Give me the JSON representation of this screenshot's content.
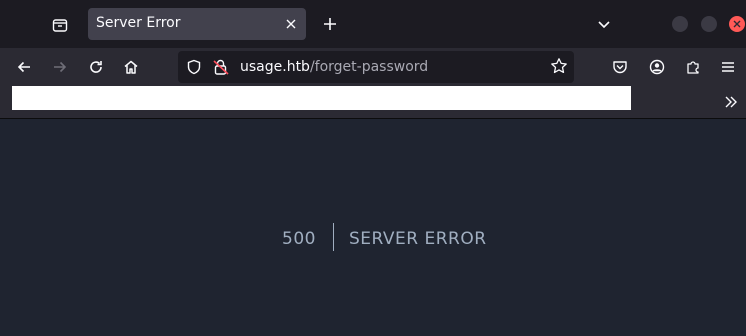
{
  "browser": {
    "tab": {
      "title": "Server Error"
    },
    "url": {
      "host": "usage.htb",
      "path": "/forget-password"
    },
    "icons": {
      "tab_list": "tab-list-icon",
      "tab_close": "close-icon",
      "new_tab": "plus-icon",
      "list_all_tabs": "chevron-down-icon",
      "back": "arrow-left-icon",
      "forward": "arrow-right-icon",
      "reload": "reload-icon",
      "home": "home-icon",
      "tracking_protection": "shield-icon",
      "connection_insecure": "lock-insecure-icon",
      "bookmark": "star-icon",
      "pocket": "pocket-icon",
      "account": "account-icon",
      "extensions": "puzzle-icon",
      "menu": "hamburger-icon",
      "bookmarks_overflow": "double-chevron-right-icon"
    },
    "colors": {
      "accent_close": "#ff5a57",
      "page_bg": "#1f2430",
      "error_text": "#a0aec0"
    }
  },
  "page": {
    "error_code": "500",
    "error_message": "SERVER ERROR"
  }
}
